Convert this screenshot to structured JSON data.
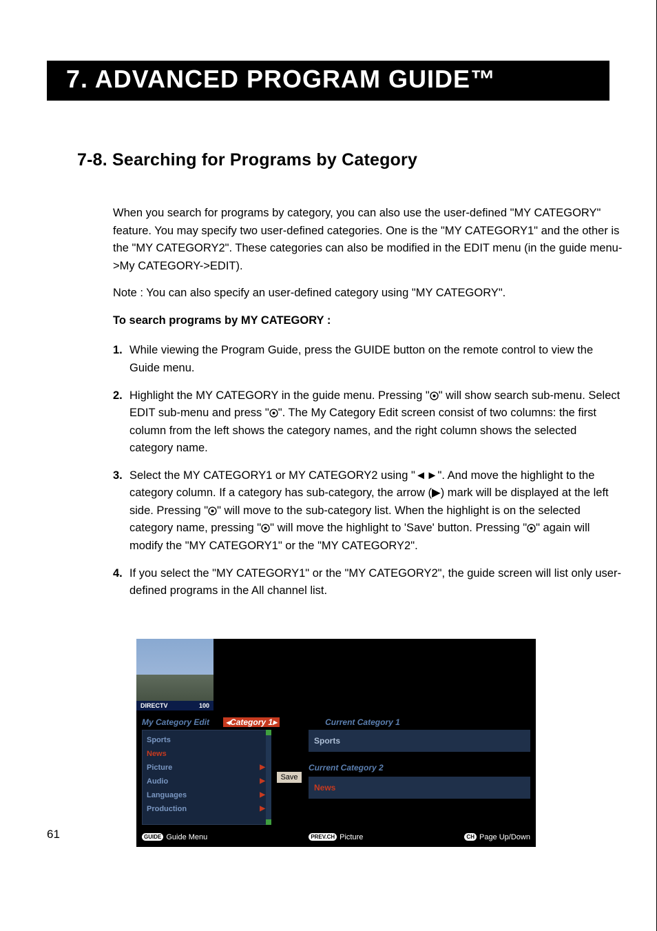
{
  "chapter_title": "7. ADVANCED PROGRAM GUIDE™",
  "section_title": "7-8.  Searching for Programs by Category",
  "intro_para": "When you search for programs by category, you can also use the user-defined \"MY CATEGORY\" feature. You may specify two user-defined categories. One is the \"MY CATEGORY1\" and the other is the \"MY CATEGORY2\". These categories can also be modified in the EDIT menu (in the guide menu->My CATEGORY->EDIT).",
  "note_para": "Note : You can also specify an user-defined category using \"MY CATEGORY\".",
  "bold_line": "To search programs by MY CATEGORY :",
  "steps": [
    {
      "num": "1.",
      "pre": "While viewing the Program Guide, press the GUIDE button on the remote control to view the Guide menu."
    },
    {
      "num": "2.",
      "p1": "Highlight the MY CATEGORY in the guide menu. Pressing \"",
      "p2": "\" will show search sub-menu. Select EDIT sub-menu and press \"",
      "p3": "\". The My Category Edit screen consist of two columns: the first column from the left shows the category names, and the right column shows the selected category name."
    },
    {
      "num": "3.",
      "p1": "Select the MY CATEGORY1 or MY CATEGORY2 using \"",
      "arrows": "◄►",
      "p2": "\". And move the highlight to the category column. If a category has sub-category, the arrow (",
      "tri": "▶",
      "p3": ") mark will be displayed at the left side. Pressing \"",
      "p4": "\" will move to the sub-category list. When the highlight is on the selected category name, pressing \"",
      "p5": "\" will move the highlight to 'Save' button. Pressing \"",
      "p6": "\" again will modify the \"MY CATEGORY1\" or the \"MY CATEGORY2\"."
    },
    {
      "num": "4.",
      "pre": "If you select the \"MY CATEGORY1\" or the \"MY CATEGORY2\", the guide screen will list only user-defined programs in the All channel list."
    }
  ],
  "screenshot": {
    "thumb_brand": "DIRECTV",
    "thumb_channel": "100",
    "mycat_label": "My Category Edit",
    "cat_tab": "◂Category 1▸",
    "cur1_label": "Current Category 1",
    "cur2_label": "Current Category 2",
    "list": [
      {
        "label": "Sports",
        "arrow": false,
        "sel": false
      },
      {
        "label": "News",
        "arrow": false,
        "sel": true
      },
      {
        "label": "Picture",
        "arrow": true,
        "sel": false
      },
      {
        "label": "Audio",
        "arrow": true,
        "sel": false
      },
      {
        "label": "Languages",
        "arrow": true,
        "sel": false
      },
      {
        "label": "Production",
        "arrow": true,
        "sel": false
      }
    ],
    "save_label": "Save",
    "field1_value": "Sports",
    "field2_value": "News",
    "footer": {
      "left_pill": "GUIDE",
      "left_label": "Guide Menu",
      "mid_pill": "PREV.CH",
      "mid_label": "Picture",
      "right_pill": "CH",
      "right_label": "Page Up/Down"
    }
  },
  "page_number": "61"
}
